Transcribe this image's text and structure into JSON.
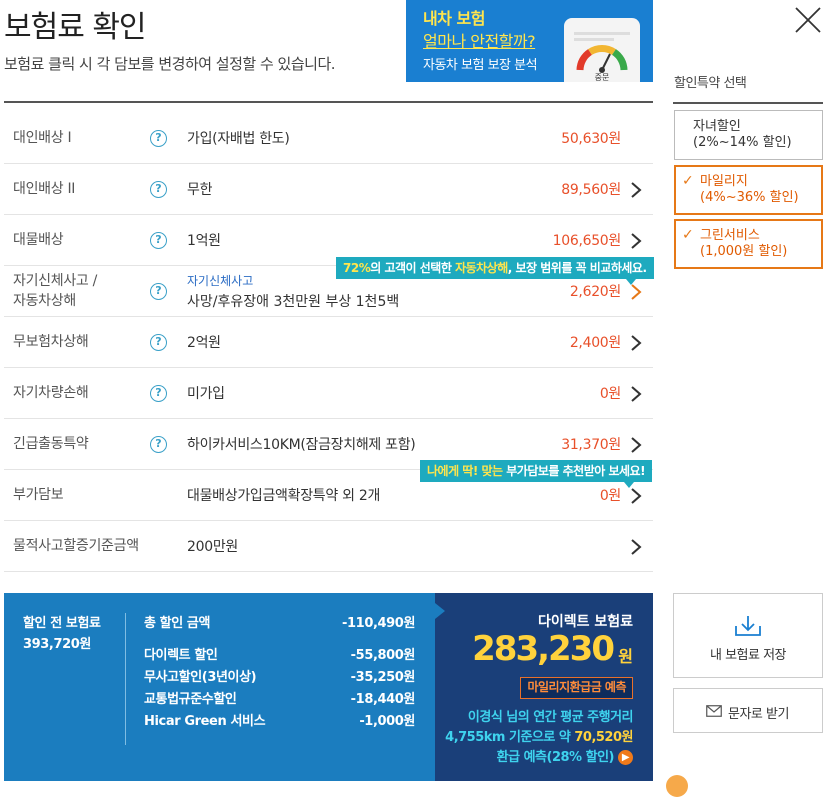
{
  "header": {
    "title": "보험료 확인",
    "subtitle": "보험료 클릭 시 각 담보를 변경하여 설정할 수 있습니다."
  },
  "banner": {
    "line1": "내차 보험",
    "line2": "얼마나 안전할까?",
    "line3": "자동차 보험 보장 분석",
    "gauge_label": "중문"
  },
  "discounts": {
    "heading": "할인특약 선택",
    "options": [
      {
        "label1": "자녀할인",
        "label2": "(2%~14% 할인)",
        "selected": false
      },
      {
        "label1": "마일리지",
        "label2": "(4%~36% 할인)",
        "selected": true
      },
      {
        "label1": "그린서비스",
        "label2": "(1,000원 할인)",
        "selected": true
      }
    ]
  },
  "coverage": [
    {
      "category": "대인배상 Ⅰ",
      "value": "가입(자배법 한도)",
      "price": "50,630원",
      "help": true,
      "arrow": false
    },
    {
      "category": "대인배상 II",
      "value": "무한",
      "price": "89,560원",
      "help": true,
      "arrow": true
    },
    {
      "category": "대물배상",
      "value": "1억원",
      "price": "106,650원",
      "help": true,
      "arrow": true
    },
    {
      "category1": "자기신체사고 /",
      "category2": "자동차상해",
      "sub": "자기신체사고",
      "value": "사망/후유장애 3천만원 부상 1천5백",
      "price": "2,620원",
      "help": true,
      "arrow": true
    },
    {
      "category": "무보험차상해",
      "value": "2억원",
      "price": "2,400원",
      "help": true,
      "arrow": true
    },
    {
      "category": "자기차량손해",
      "value": "미가입",
      "price": "0원",
      "help": true,
      "arrow": true
    },
    {
      "category": "긴급출동특약",
      "value": "하이카서비스10KM(잠금장치해제 포함)",
      "price": "31,370원",
      "help": true,
      "arrow": true
    },
    {
      "category": "부가담보",
      "value": "대물배상가입금액확장특약 외 2개",
      "price": "0원",
      "help": false,
      "arrow": true
    },
    {
      "category": "물적사고할증기준금액",
      "value": "200만원",
      "price": "",
      "help": false,
      "arrow": true
    }
  ],
  "tips": {
    "tip1_pct": "72%",
    "tip1_mid": "의 고객이 선택한 ",
    "tip1_hl": "자동차상해",
    "tip1_end": ", 보장 범위를 꼭 비교하세요.",
    "tip2_hl": "나에게 딱! 맞는",
    "tip2_end": " 부가담보를 추천받아 보세요!"
  },
  "summary": {
    "before_label": "할인 전 보험료",
    "before_value": "393,720원",
    "total_label": "총 할인 금액",
    "total_value": "-110,490원",
    "items": [
      {
        "label": "다이렉트 할인",
        "value": "-55,800원"
      },
      {
        "label": "무사고할인(3년이상)",
        "value": "-35,250원"
      },
      {
        "label": "교통법규준수할인",
        "value": "-18,440원"
      },
      {
        "label": "Hicar Green 서비스",
        "value": "-1,000원"
      }
    ]
  },
  "direct": {
    "label": "다이렉트 보험료",
    "amount": "283,230",
    "unit": "원",
    "refund_button": "마일리지환급금 예측",
    "note1": "이경식 님의 연간 평균 주행거리",
    "note2a": "4,755km 기준으로 약 ",
    "note2b": "70,520원",
    "note3": "환급 예측(28% 할인)"
  },
  "side": {
    "save_label": "내 보험료 저장",
    "sms_label": "문자로 받기"
  },
  "colors": {
    "accent_orange": "#e67817",
    "price_red": "#e8502a",
    "summary_blue": "#1b7dbf",
    "direct_navy": "#1a3f79",
    "tip_teal": "#1eaabf",
    "highlight_yellow": "#ffd23c"
  }
}
